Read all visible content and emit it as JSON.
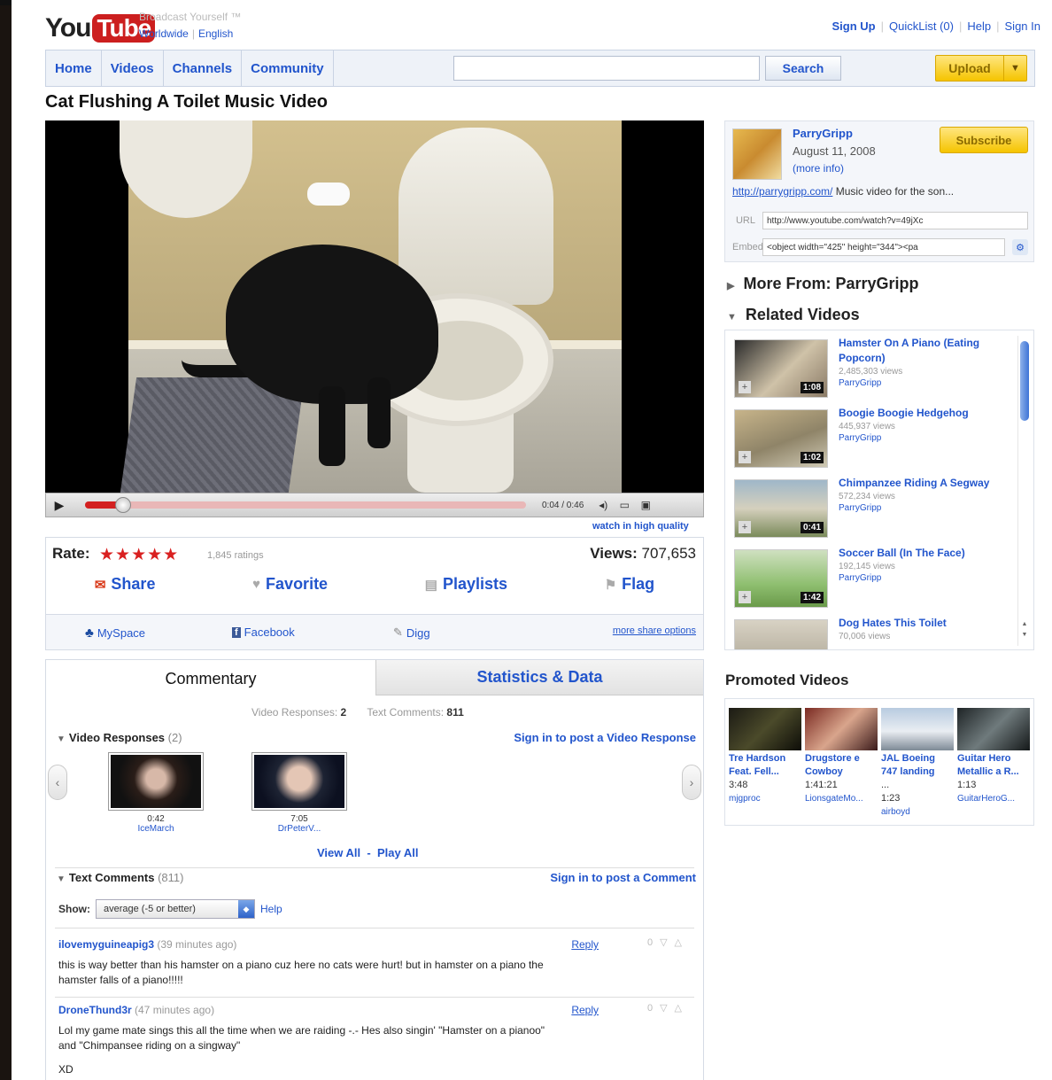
{
  "header": {
    "logo_you": "You",
    "logo_tube": "Tube",
    "tagline": "Broadcast Yourself ™",
    "locale": [
      "Worldwide",
      "English"
    ],
    "links": [
      "Sign Up",
      "QuickList (0)",
      "Help",
      "Sign In"
    ]
  },
  "nav": {
    "tabs": [
      "Home",
      "Videos",
      "Channels",
      "Community"
    ],
    "search_value": "",
    "search_label": "Search",
    "upload_label": "Upload"
  },
  "video": {
    "title": "Cat Flushing A Toilet Music Video",
    "time": "0:04 / 0:46",
    "progress_fraction": 0.087,
    "hq_link": "watch in high quality"
  },
  "rating": {
    "label": "Rate:",
    "stars": "★★★★★",
    "count": "1,845 ratings",
    "views_label": "Views:",
    "views_value": "707,653"
  },
  "actions": [
    "Share",
    "Favorite",
    "Playlists",
    "Flag"
  ],
  "share_services": [
    "MySpace",
    "Facebook",
    "Digg"
  ],
  "more_share": "more share options",
  "tabs": [
    "Commentary",
    "Statistics & Data"
  ],
  "counts": {
    "responses_label": "Video Responses:",
    "responses_value": "2",
    "comments_label": "Text Comments:",
    "comments_value": "811"
  },
  "video_responses": {
    "title": "Video Responses",
    "count": "(2)",
    "signin": "Sign in to post a Video Response",
    "items": [
      {
        "duration": "0:42",
        "user": "IceMarch"
      },
      {
        "duration": "7:05",
        "user": "DrPeterV..."
      }
    ],
    "view_all": "View All",
    "dash": "-",
    "play_all": "Play All"
  },
  "text_comments": {
    "title": "Text Comments",
    "count": "(811)",
    "signin": "Sign in to post a Comment",
    "show_label": "Show:",
    "show_value": "average (-5 or better)",
    "help": "Help",
    "items": [
      {
        "user": "ilovemyguineapig3",
        "ago": "(39 minutes ago)",
        "text": "this is way better than his hamster on a piano cuz here no cats were hurt! but in hamster on a piano the hamster falls of a piano!!!!!",
        "reply": "Reply",
        "score": "0"
      },
      {
        "user": "DroneThund3r",
        "ago": "(47 minutes ago)",
        "text": "Lol my game mate sings this all the time when we are raiding -.- Hes also singin' \"Hamster on a pianoo\" and \"Chimpansee riding on a singway\"",
        "text2": "XD",
        "reply": "Reply",
        "score": "0"
      }
    ]
  },
  "uploader": {
    "channel": "ParryGripp",
    "date": "August 11, 2008",
    "more_info": "(more info)",
    "subscribe": "Subscribe",
    "desc_link": "http://parrygripp.com/",
    "desc_text": " Music video for the son...",
    "url_label": "URL",
    "url_value": "http://www.youtube.com/watch?v=49jXc",
    "embed_label": "Embed",
    "embed_value": "<object width=\"425\" height=\"344\"><pa"
  },
  "sidebar": {
    "more_from": "More From: ParryGripp",
    "related_title": "Related Videos",
    "related": [
      {
        "title": "Hamster On A Piano (Eating Popcorn)",
        "views": "2,485,303 views",
        "user": "ParryGripp",
        "duration": "1:08"
      },
      {
        "title": "Boogie Boogie Hedgehog",
        "views": "445,937 views",
        "user": "ParryGripp",
        "duration": "1:02"
      },
      {
        "title": "Chimpanzee Riding A Segway",
        "views": "572,234 views",
        "user": "ParryGripp",
        "duration": "0:41"
      },
      {
        "title": "Soccer Ball (In The Face)",
        "views": "192,145 views",
        "user": "ParryGripp",
        "duration": "1:42"
      },
      {
        "title": "Dog Hates This Toilet",
        "views": "70,006 views",
        "user": "",
        "duration": ""
      }
    ],
    "promoted_title": "Promoted Videos",
    "promoted": [
      {
        "t1": "Tre Hardson",
        "t2": "Feat. Fell...",
        "duration": "3:48",
        "user": "mjgproc"
      },
      {
        "t1": "Drugstore e",
        "t2": "Cowboy",
        "duration": "1:41:21",
        "user": "LionsgateMo..."
      },
      {
        "t1": "JAL Boeing",
        "t2": "747 landing",
        "duration": "1:23",
        "user": "airboyd"
      },
      {
        "t1": "Guitar Hero",
        "t2": "Metallic a R...",
        "duration": "1:13",
        "user": "GuitarHeroG..."
      }
    ]
  }
}
